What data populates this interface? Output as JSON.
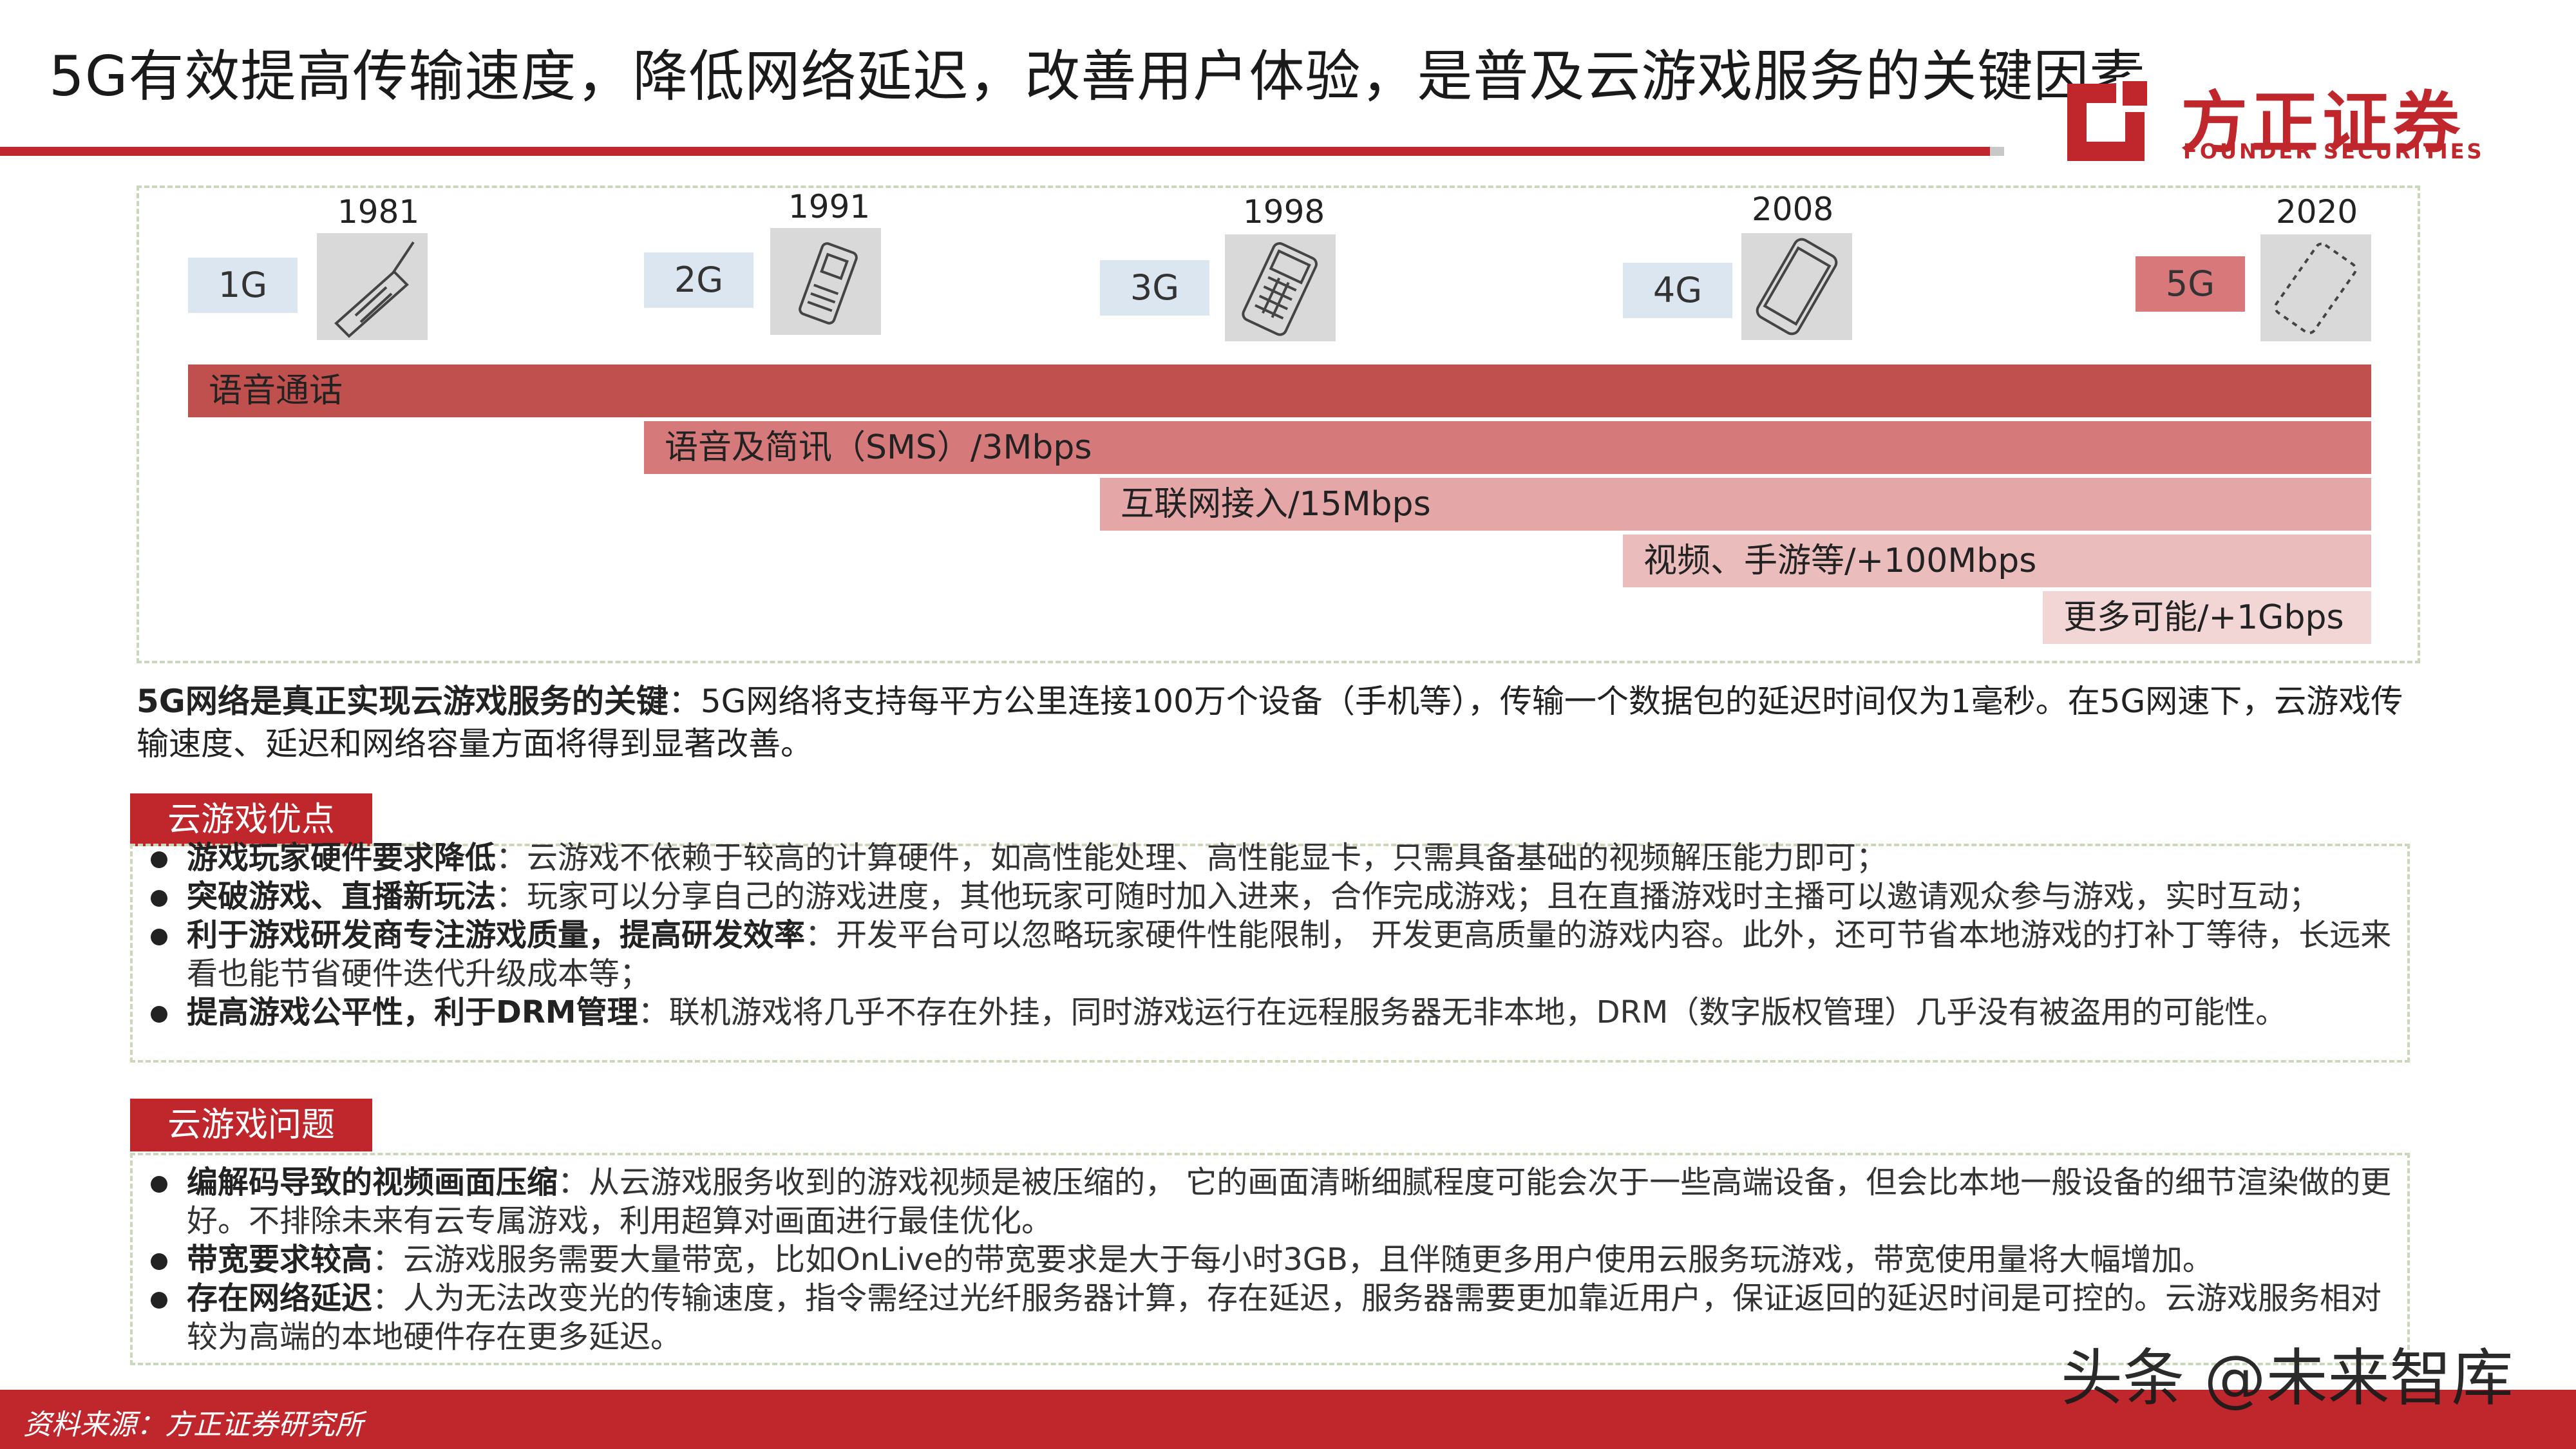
{
  "header": {
    "title": "5G有效提高传输速度，降低网络延迟，改善用户体验，是普及云游戏服务的关键因素",
    "logo_cn": "方正证券",
    "logo_en": "FOUNDER SECURITIES"
  },
  "timeline": {
    "generations": [
      {
        "label": "1G",
        "year": "1981",
        "icon": "brick-phone-icon"
      },
      {
        "label": "2G",
        "year": "1991",
        "icon": "feature-phone-icon"
      },
      {
        "label": "3G",
        "year": "1998",
        "icon": "keypad-phone-icon"
      },
      {
        "label": "4G",
        "year": "2008",
        "icon": "smartphone-icon"
      },
      {
        "label": "5G",
        "year": "2020",
        "icon": "future-phone-icon"
      }
    ],
    "bars": [
      {
        "label": "语音通话"
      },
      {
        "label": "语音及简讯（SMS）/3Mbps"
      },
      {
        "label": "互联网接入/15Mbps"
      },
      {
        "label": "视频、手游等/+100Mbps"
      },
      {
        "label": "更多可能/+1Gbps"
      }
    ]
  },
  "summary": {
    "lead": "5G网络是真正实现云游戏服务的关键",
    "text": "：5G网络将支持每平方公里连接100万个设备（手机等），传输一个数据包的延迟时间仅为1毫秒。在5G网速下，云游戏传输速度、延迟和网络容量方面将得到显著改善。"
  },
  "advantages": {
    "tab": "云游戏优点",
    "items": [
      {
        "bold": "游戏玩家硬件要求降低",
        "text": "：云游戏不依赖于较高的计算硬件，如高性能处理、高性能显卡，只需具备基础的视频解压能力即可；"
      },
      {
        "bold": "突破游戏、直播新玩法",
        "text": "：玩家可以分享自己的游戏进度，其他玩家可随时加入进来，合作完成游戏；且在直播游戏时主播可以邀请观众参与游戏，实时互动；"
      },
      {
        "bold": "利于游戏研发商专注游戏质量，提高研发效率",
        "text": "：开发平台可以忽略玩家硬件性能限制， 开发更高质量的游戏内容。此外，还可节省本地游戏的打补丁等待，长远来看也能节省硬件迭代升级成本等；"
      },
      {
        "bold": "提高游戏公平性，利于DRM管理",
        "text": "：联机游戏将几乎不存在外挂，同时游戏运行在远程服务器无非本地，DRM（数字版权管理）几乎没有被盗用的可能性。"
      }
    ]
  },
  "problems": {
    "tab": "云游戏问题",
    "items": [
      {
        "bold": "编解码导致的视频画面压缩",
        "text": "：从云游戏服务收到的游戏视频是被压缩的， 它的画面清晰细腻程度可能会次于一些高端设备，但会比本地一般设备的细节渲染做的更好。不排除未来有云专属游戏，利用超算对画面进行最佳优化。"
      },
      {
        "bold": "带宽要求较高",
        "text": "：云游戏服务需要大量带宽，比如OnLive的带宽要求是大于每小时3GB，且伴随更多用户使用云服务玩游戏，带宽使用量将大幅增加。"
      },
      {
        "bold": "存在网络延迟",
        "text": "：人为无法改变光的传输速度，指令需经过光纤服务器计算，存在延迟，服务器需要更加靠近用户，保证返回的延迟时间是可控的。云游戏服务相对较为高端的本地硬件存在更多延迟。"
      }
    ]
  },
  "footer": {
    "source": "资料来源：方正证券研究所",
    "watermark": "头条 @未来智库"
  },
  "colors": {
    "brand_red": "#c0272d",
    "gen_badge_blue": "#dce6f0",
    "gen_badge_5g": "#d9787a",
    "bar_1": "#c0504d",
    "bar_2": "#d5797a",
    "bar_3": "#e4a6a6",
    "bar_4": "#ebbcbc",
    "bar_5": "#f2d6d6"
  }
}
